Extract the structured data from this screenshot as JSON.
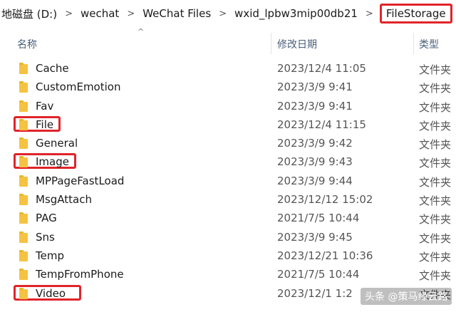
{
  "breadcrumb": [
    {
      "label": "地磁盘 (D:)"
    },
    {
      "label": "wechat"
    },
    {
      "label": "WeChat Files"
    },
    {
      "label": "wxid_lpbw3mip00db21"
    },
    {
      "label": "FileStorage"
    }
  ],
  "separator": ">",
  "sort_indicator": "^",
  "columns": {
    "name": "名称",
    "date": "修改日期",
    "type": "类型"
  },
  "files": [
    {
      "name": "Cache",
      "date": "2023/12/4 11:05",
      "type": "文件夹",
      "highlighted": false
    },
    {
      "name": "CustomEmotion",
      "date": "2023/3/9 9:41",
      "type": "文件夹",
      "highlighted": false
    },
    {
      "name": "Fav",
      "date": "2023/3/9 9:41",
      "type": "文件夹",
      "highlighted": false
    },
    {
      "name": "File",
      "date": "2023/12/4 11:15",
      "type": "文件夹",
      "highlighted": true
    },
    {
      "name": "General",
      "date": "2023/3/9 9:42",
      "type": "文件夹",
      "highlighted": false
    },
    {
      "name": "Image",
      "date": "2023/3/9 9:43",
      "type": "文件夹",
      "highlighted": true
    },
    {
      "name": "MPPageFastLoad",
      "date": "2023/3/9 9:44",
      "type": "文件夹",
      "highlighted": false
    },
    {
      "name": "MsgAttach",
      "date": "2023/12/12 15:02",
      "type": "文件夹",
      "highlighted": false
    },
    {
      "name": "PAG",
      "date": "2021/7/5 10:44",
      "type": "文件夹",
      "highlighted": false
    },
    {
      "name": "Sns",
      "date": "2023/3/9 9:45",
      "type": "文件夹",
      "highlighted": false
    },
    {
      "name": "Temp",
      "date": "2023/12/21 10:36",
      "type": "文件夹",
      "highlighted": false
    },
    {
      "name": "TempFromPhone",
      "date": "2021/7/5 10:44",
      "type": "文件夹",
      "highlighted": false
    },
    {
      "name": "Video",
      "date": "2023/12/1 1:2",
      "type": "文件夹",
      "highlighted": true
    }
  ],
  "watermark": "头条 @策马缘云路",
  "colors": {
    "highlight_border": "#e0242a",
    "folder_yellow": "#f5c342",
    "header_text": "#4a5f7a"
  }
}
